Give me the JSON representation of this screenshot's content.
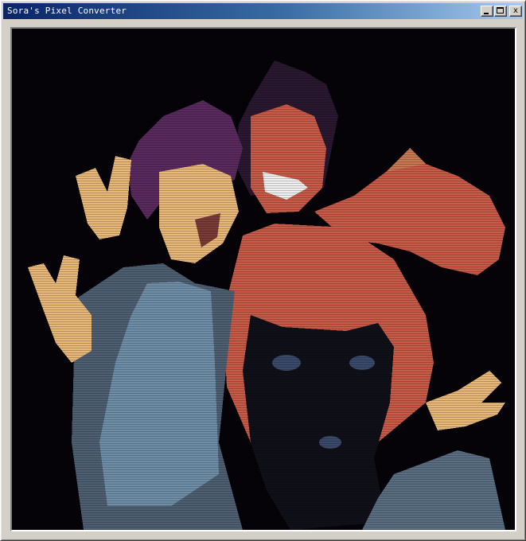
{
  "window": {
    "title": "Sora's Pixel Converter",
    "controls": {
      "minimize": "minimize",
      "maximize": "maximize",
      "close": "x"
    }
  },
  "canvas": {
    "content": "pixel-art illustration",
    "palette": {
      "background": "#050308",
      "hair_purple": "#5a2a5e",
      "hair_dark": "#2a1830",
      "skin_light": "#e8b878",
      "skin_shade": "#c87850",
      "skin_dark": "#7a3a36",
      "tan_skin": "#c85a48",
      "shirt_blue": "#6f8fa8",
      "jacket_grey": "#4e5f72",
      "swimsuit": "#101018",
      "jeans": "#5a6e82",
      "outline": "#1a1020"
    }
  }
}
